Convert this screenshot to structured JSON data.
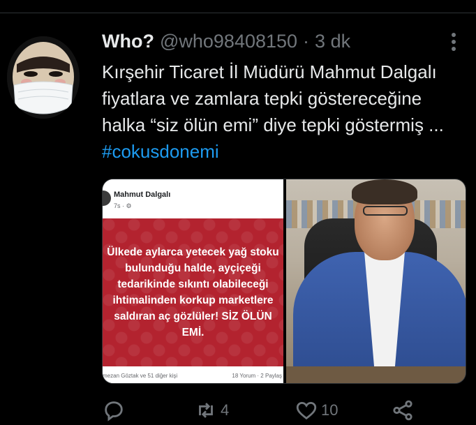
{
  "tweet": {
    "display_name": "Who?",
    "handle": "@who98408150",
    "separator": "·",
    "time": "3 dk",
    "text": "Kırşehir Ticaret İl Müdürü Mahmut Dalgalı fiyatlara ve zamlara tepki göstereceğine halka “siz ölün emi” diye tepki göstermiş ... ",
    "hashtag": "#cokusdonemi"
  },
  "media": {
    "fb_post": {
      "author": "Mahmut Dalgalı",
      "meta": "7s · ⚙",
      "quote": "Ülkede aylarca yetecek yağ stoku bulunduğu halde, ayçiçeği tedarikinde sıkıntı olabileceği ihtimalinden korkup marketlere saldıran aç gözlüler! SİZ ÖLÜN EMİ.",
      "likes": "mezan Göztak ve 51 diğer kişi",
      "comments": "18 Yorum · 2 Paylaş"
    }
  },
  "actions": {
    "reply_count": "",
    "retweet_count": "4",
    "like_count": "10"
  },
  "icons": [
    "more-icon",
    "reply-icon",
    "retweet-icon",
    "like-icon",
    "share-icon"
  ],
  "colors": {
    "accent": "#1d9bf0",
    "muted": "#71767b",
    "text": "#e7e9ea",
    "background": "#000000",
    "fb_card": "#b3232f"
  }
}
